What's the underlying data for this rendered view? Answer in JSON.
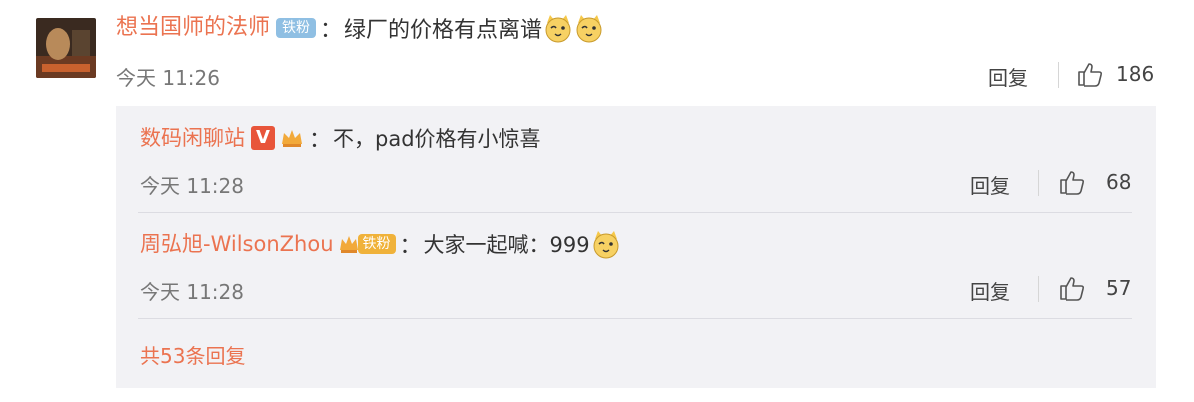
{
  "comment": {
    "author": "想当国师的法师",
    "fan_badge": "铁粉",
    "colon": "：",
    "text": "绿厂的价格有点离谱",
    "time": "今天 11:26",
    "reply_label": "回复",
    "like_count": "186"
  },
  "replies": [
    {
      "author": "数码闲聊站",
      "vip_label": "V",
      "colon": "：",
      "text": "不，pad价格有小惊喜",
      "time": "今天 11:28",
      "reply_label": "回复",
      "like_count": "68"
    },
    {
      "author": "周弘旭-WilsonZhou",
      "fan_badge": "铁粉",
      "colon": "：",
      "text": "大家一起喊：999",
      "time": "今天 11:28",
      "reply_label": "回复",
      "like_count": "57"
    }
  ],
  "more_replies": "共53条回复",
  "colors": {
    "accent": "#eb7350",
    "reply_bg": "#f2f2f5",
    "fan_badge": "#8fbfe3",
    "vip": "#e8553a"
  },
  "icons": [
    "thumbs-up-icon",
    "cat-emoji-icon",
    "vip-v-icon",
    "crown-badge-icon"
  ]
}
